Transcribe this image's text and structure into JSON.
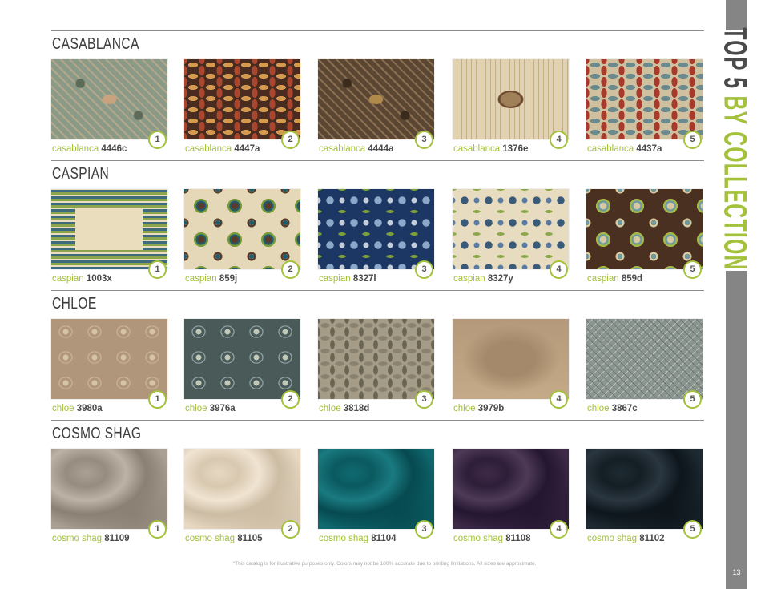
{
  "sidebar": {
    "title_part1": "TOP 5",
    "title_part2": "BY COLLECTION",
    "page_number": "13"
  },
  "footer": {
    "disclaimer": "*This catalog is for illustrative purposes only. Colors may not be 100% accurate due to printing limitations. All sizes are approximate."
  },
  "sections": [
    {
      "title": "CASABLANCA",
      "items": [
        {
          "rank": "1",
          "prefix": "casablanca",
          "code": "4446c",
          "pattern": "persian",
          "colors": [
            "#8a9a86",
            "#b3a88c",
            "#c9a37e",
            "#5d6b59"
          ]
        },
        {
          "rank": "2",
          "prefix": "casablanca",
          "code": "4447a",
          "pattern": "ikat",
          "colors": [
            "#4a2b20",
            "#a8462e",
            "#d39a50",
            "#2f1c15"
          ]
        },
        {
          "rank": "3",
          "prefix": "casablanca",
          "code": "4444a",
          "pattern": "persian",
          "colors": [
            "#5a4632",
            "#8a7050",
            "#b08a4a",
            "#3a2b1d"
          ]
        },
        {
          "rank": "4",
          "prefix": "casablanca",
          "code": "1376e",
          "pattern": "medallion",
          "colors": [
            "#e0d2b4",
            "#a08058",
            "#6b4a30",
            "#c4ae86"
          ]
        },
        {
          "rank": "5",
          "prefix": "casablanca",
          "code": "4437a",
          "pattern": "ikat",
          "colors": [
            "#cfc0a0",
            "#a83a2c",
            "#6a8a8e",
            "#b88a3a"
          ]
        }
      ]
    },
    {
      "title": "CASPIAN",
      "items": [
        {
          "rank": "1",
          "prefix": "caspian",
          "code": "1003x",
          "pattern": "border",
          "colors": [
            "#e9ddbd",
            "#3d6a7c",
            "#274d60",
            "#8ca44c"
          ]
        },
        {
          "rank": "2",
          "prefix": "caspian",
          "code": "859j",
          "pattern": "suzani",
          "colors": [
            "#e4d8b8",
            "#1f5c70",
            "#7a9a3a",
            "#5a3a2a"
          ]
        },
        {
          "rank": "3",
          "prefix": "caspian",
          "code": "8327l",
          "pattern": "floral",
          "colors": [
            "#1d3764",
            "#7ea03c",
            "#c4ccd8",
            "#8aa8c8"
          ]
        },
        {
          "rank": "4",
          "prefix": "caspian",
          "code": "8327y",
          "pattern": "floral",
          "colors": [
            "#e8dcc0",
            "#8aa84a",
            "#5a7ca4",
            "#3a5a7a"
          ]
        },
        {
          "rank": "5",
          "prefix": "caspian",
          "code": "859d",
          "pattern": "suzani",
          "colors": [
            "#4a3020",
            "#6a9aa4",
            "#a8b848",
            "#d8c8a0"
          ]
        }
      ]
    },
    {
      "title": "CHLOE",
      "items": [
        {
          "rank": "1",
          "prefix": "chloe",
          "code": "3980a",
          "pattern": "ogee",
          "colors": [
            "#b0967a",
            "#c8b294",
            "#9a8064",
            "#d6c4a8"
          ]
        },
        {
          "rank": "2",
          "prefix": "chloe",
          "code": "3976a",
          "pattern": "ogee",
          "colors": [
            "#4a5a58",
            "#8aa0a0",
            "#3a4644",
            "#c0c8b8"
          ]
        },
        {
          "rank": "3",
          "prefix": "chloe",
          "code": "3818d",
          "pattern": "vine",
          "colors": [
            "#a49c86",
            "#8a8270",
            "#c2b8a0",
            "#6a6452"
          ]
        },
        {
          "rank": "4",
          "prefix": "chloe",
          "code": "3979b",
          "pattern": "plain",
          "colors": [
            "#b49a7a",
            "#c4aa88",
            "#a48a6a",
            "#d0b896"
          ]
        },
        {
          "rank": "5",
          "prefix": "chloe",
          "code": "3867c",
          "pattern": "damask",
          "colors": [
            "#8a9490",
            "#a4aca4",
            "#6a7470",
            "#c0c4b8"
          ]
        }
      ]
    },
    {
      "title": "COSMO SHAG",
      "items": [
        {
          "rank": "1",
          "prefix": "cosmo shag",
          "code": "81109",
          "pattern": "shag",
          "colors": [
            "#aaa094",
            "#968c80",
            "#bcb2a6",
            "#8a8074"
          ]
        },
        {
          "rank": "2",
          "prefix": "cosmo shag",
          "code": "81105",
          "pattern": "shag",
          "colors": [
            "#e6d8c2",
            "#d8c8b0",
            "#f0e4d2",
            "#ccbca4"
          ]
        },
        {
          "rank": "3",
          "prefix": "cosmo shag",
          "code": "81104",
          "pattern": "shag",
          "colors": [
            "#0f6a70",
            "#0a5a60",
            "#1a7a80",
            "#064a50"
          ]
        },
        {
          "rank": "4",
          "prefix": "cosmo shag",
          "code": "81108",
          "pattern": "shag",
          "colors": [
            "#3e2a48",
            "#2e1e38",
            "#4e3a58",
            "#241630"
          ]
        },
        {
          "rank": "5",
          "prefix": "cosmo shag",
          "code": "81102",
          "pattern": "shag",
          "colors": [
            "#1e2a32",
            "#141e24",
            "#2a3640",
            "#0e161c"
          ]
        }
      ]
    }
  ]
}
